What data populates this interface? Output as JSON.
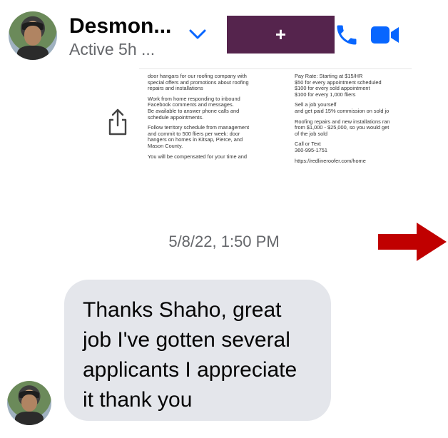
{
  "header": {
    "name": "Desmon...",
    "status": "Active 5h ...",
    "add_label": "+",
    "brand_color": "#0866ff",
    "button_color": "#55244d"
  },
  "attachment": {
    "left_lines": [
      "door hangars for our roofing company with\nspecial offers and promotions about roofing\nrepairs and installations",
      "Work from home responding to inbound\nFacebook comments and messages.\nBe available to answer phone calls and\nschedule appointments.",
      "Follow territory schedule from management\nand commit to 500 fliers per week: door\nhangers on homes in Kitsap, Pierce, and\nMason County.",
      "You will be compensated for your time and"
    ],
    "right_lines": [
      "Pay Rate: Starting at $15/HR\n$50 for every appointment scheduled\n$100 for every sold appointment\n$100 for every 1,000 fliers",
      "Sell a job yourself\nand get paid 15% commission on sold jo",
      "Roofing repairs and new installations ran\nfrom $1,000 - $25,000, so you would get\nof the job sold",
      "Call or Text\n360-995-1751",
      "https://redlineroofer.com/home"
    ]
  },
  "timestamp": "5/8/22, 1:50 PM",
  "message": {
    "text": "Thanks Shaho, great job I've gotten several applicants I appreciate it thank you",
    "bubble_color": "#e4e6eb"
  },
  "annotation_arrow_color": "#c00000"
}
